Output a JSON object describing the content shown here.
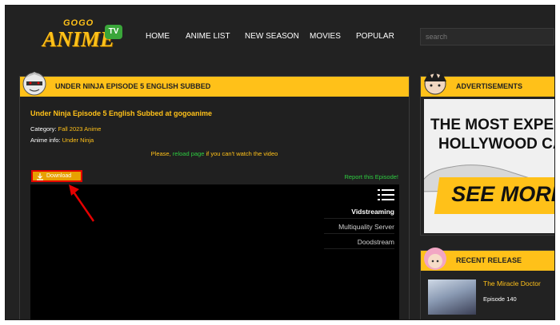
{
  "header": {
    "logo_top": "GOGO",
    "logo_main": "ANIME",
    "logo_badge": "TV",
    "nav": [
      "HOME",
      "ANIME LIST",
      "NEW SEASON",
      "MOVIES",
      "POPULAR"
    ],
    "search_placeholder": "search"
  },
  "episode": {
    "bar_title": "UNDER NINJA EPISODE 5 ENGLISH SUBBED",
    "title": "Under Ninja Episode 5 English Subbed at gogoanime",
    "category_label": "Category:",
    "category_value": "Fall 2023 Anime",
    "info_label": "Anime info:",
    "info_value": "Under Ninja",
    "reload_pre": "Please,",
    "reload_link": "reload page",
    "reload_post": "if you can't watch the video",
    "download_label": "Download",
    "report_label": "Report this Episode!",
    "servers": [
      "Vidstreaming",
      "Multiquality Server",
      "Doodstream"
    ]
  },
  "sidebar": {
    "ads_title": "ADVERTISEMENTS",
    "ad_line1": "THE MOST EXPENSI",
    "ad_line2": "HOLLYWOOD CARS",
    "ad_cta": "SEE MORE",
    "recent_title": "RECENT RELEASE",
    "recent_item_title": "The Miracle Doctor",
    "recent_item_episode": "Episode 140"
  },
  "colors": {
    "accent": "#ffc119",
    "background": "#222222",
    "link_green": "#2ecc40",
    "highlight_red": "#e50000"
  }
}
